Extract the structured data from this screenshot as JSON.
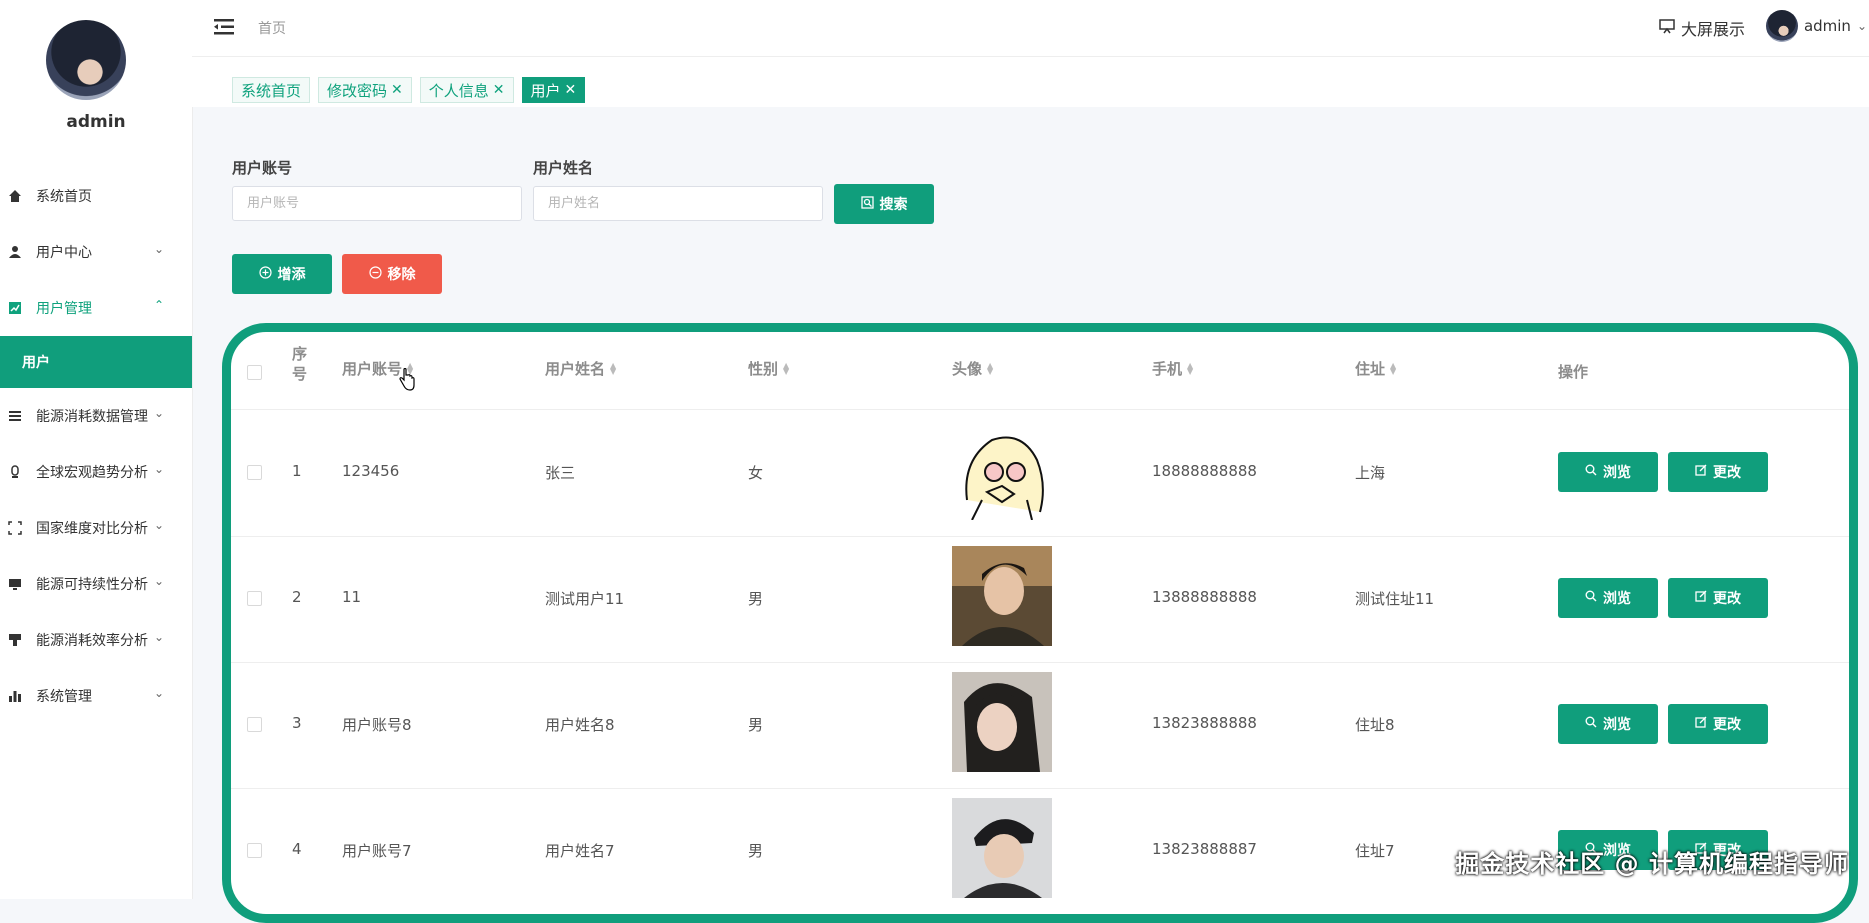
{
  "sidebar": {
    "username": "admin",
    "items": [
      {
        "label": "系统首页",
        "icon": "home-icon"
      },
      {
        "label": "用户中心",
        "icon": "user-icon"
      },
      {
        "label": "用户管理",
        "icon": "chart-line-icon"
      },
      {
        "label": "能源消耗数据管理",
        "icon": "list-icon"
      },
      {
        "label": "全球宏观趋势分析",
        "icon": "thermometer-icon"
      },
      {
        "label": "国家维度对比分析",
        "icon": "frame-icon"
      },
      {
        "label": "能源可持续性分析",
        "icon": "monitor-icon"
      },
      {
        "label": "能源消耗效率分析",
        "icon": "brush-icon"
      },
      {
        "label": "系统管理",
        "icon": "bar-chart-icon"
      }
    ],
    "submenu_active": "用户"
  },
  "topbar": {
    "breadcrumb": "首页",
    "big_screen_label": "大屏展示",
    "username": "admin"
  },
  "tags": [
    {
      "label": "系统首页",
      "closable": false,
      "active": false
    },
    {
      "label": "修改密码",
      "closable": true,
      "active": false
    },
    {
      "label": "个人信息",
      "closable": true,
      "active": false
    },
    {
      "label": "用户",
      "closable": true,
      "active": true
    }
  ],
  "search": {
    "account_label": "用户账号",
    "account_placeholder": "用户账号",
    "name_label": "用户姓名",
    "name_placeholder": "用户姓名",
    "search_button": "搜索"
  },
  "actions": {
    "add_button": "增添",
    "remove_button": "移除"
  },
  "table": {
    "headers": {
      "index": "序号",
      "account": "用户账号",
      "name": "用户姓名",
      "gender": "性别",
      "avatar": "头像",
      "phone": "手机",
      "address": "住址",
      "ops": "操作"
    },
    "view_label": "浏览",
    "edit_label": "更改",
    "rows": [
      {
        "index": "1",
        "account": "123456",
        "name": "张三",
        "gender": "女",
        "phone": "18888888888",
        "address": "上海"
      },
      {
        "index": "2",
        "account": "11",
        "name": "测试用户11",
        "gender": "男",
        "phone": "13888888888",
        "address": "测试住址11"
      },
      {
        "index": "3",
        "account": "用户账号8",
        "name": "用户姓名8",
        "gender": "男",
        "phone": "13823888888",
        "address": "住址8"
      },
      {
        "index": "4",
        "account": "用户账号7",
        "name": "用户姓名7",
        "gender": "男",
        "phone": "13823888887",
        "address": "住址7"
      }
    ]
  },
  "watermark": "掘金技术社区 @ 计算机编程指导师",
  "colors": {
    "accent": "#109e7c",
    "danger": "#f05a4a"
  }
}
